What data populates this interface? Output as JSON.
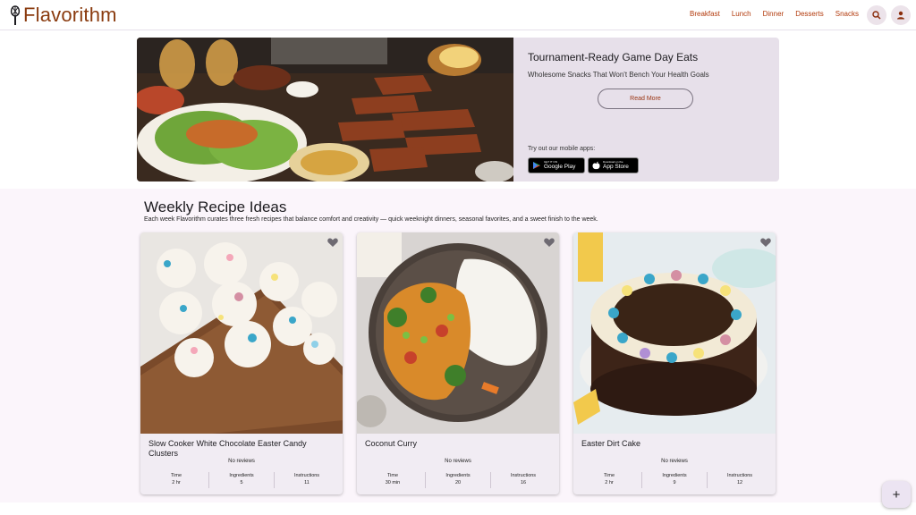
{
  "brand": {
    "name": "Flavorithm"
  },
  "nav": {
    "items": [
      "Breakfast",
      "Lunch",
      "Dinner",
      "Desserts",
      "Snacks"
    ],
    "search_icon": "search-icon",
    "user_icon": "account-icon"
  },
  "hero": {
    "title": "Tournament-Ready Game Day Eats",
    "subtitle": "Wholesome Snacks That Won't Bench Your Health Goals",
    "cta": "Read More",
    "apps_label": "Try out our mobile apps:",
    "google_play": {
      "small": "GET IT ON",
      "big": "Google Play"
    },
    "app_store": {
      "small": "Download on the",
      "big": "App Store"
    }
  },
  "weekly": {
    "title": "Weekly Recipe Ideas",
    "description": "Each week Flavorithm curates three fresh recipes that balance comfort and creativity — quick weeknight dinners, seasonal favorites, and a sweet finish to the week."
  },
  "recipes": [
    {
      "title": "Slow Cooker White Chocolate Easter Candy Clusters",
      "reviews": "No reviews",
      "time_label": "Time",
      "time": "2 hr",
      "ingredients_label": "Ingredients",
      "ingredients": "5",
      "instructions_label": "Instructions",
      "instructions": "11"
    },
    {
      "title": "Coconut Curry",
      "reviews": "No reviews",
      "time_label": "Time",
      "time": "30 min",
      "ingredients_label": "Ingredients",
      "ingredients": "20",
      "instructions_label": "Instructions",
      "instructions": "16"
    },
    {
      "title": "Easter Dirt Cake",
      "reviews": "No reviews",
      "time_label": "Time",
      "time": "2 hr",
      "ingredients_label": "Ingredients",
      "ingredients": "9",
      "instructions_label": "Instructions",
      "instructions": "12"
    }
  ],
  "fab": {
    "label": "+"
  },
  "colors": {
    "accent": "#b23a0c",
    "brand": "#8a3b0f",
    "surface": "#f1ecf3"
  }
}
